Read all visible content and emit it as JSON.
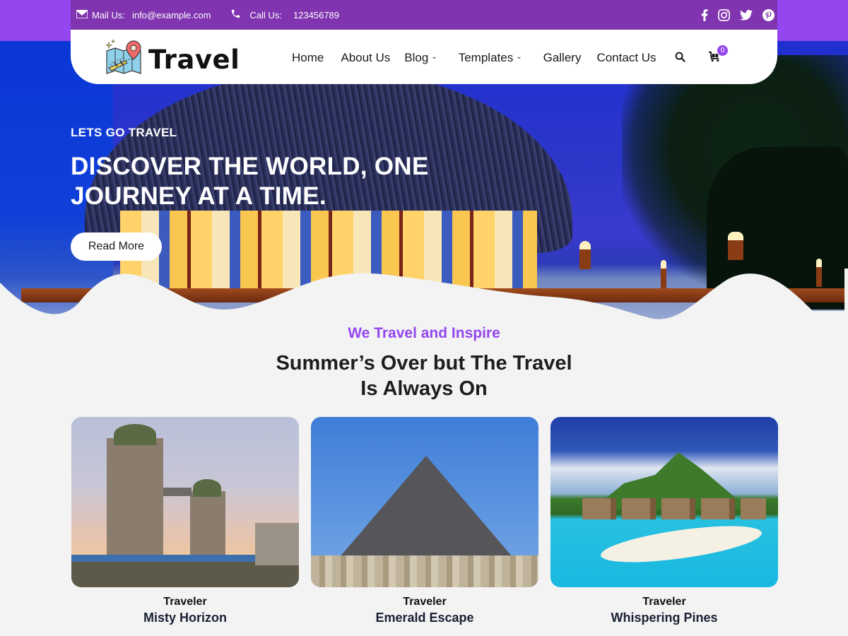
{
  "topbar": {
    "mail_label": "Mail Us:",
    "mail_value": "info@example.com",
    "call_label": "Call Us:",
    "call_value": "123456789",
    "social": [
      "facebook-icon",
      "instagram-icon",
      "twitter-icon",
      "pinterest-icon"
    ]
  },
  "brand": {
    "name": "Travel"
  },
  "nav": {
    "items": [
      {
        "label": "Home",
        "dropdown": false
      },
      {
        "label": "About Us",
        "dropdown": false
      },
      {
        "label": "Blog",
        "dropdown": true
      },
      {
        "label": "Templates",
        "dropdown": true
      },
      {
        "label": "Gallery",
        "dropdown": false
      },
      {
        "label": "Contact Us",
        "dropdown": false
      }
    ],
    "cart_count": "0"
  },
  "hero": {
    "subtitle": "LETS GO TRAVEL",
    "title": "DISCOVER THE WORLD, ONE JOURNEY AT A TIME.",
    "button_label": "Read More"
  },
  "section": {
    "eyebrow": "We Travel and Inspire",
    "heading_line1": "Summer’s Over but The Travel",
    "heading_line2": "Is Always On",
    "cards": [
      {
        "kicker": "Traveler",
        "title": "Misty Horizon",
        "image": "tower-bridge-london"
      },
      {
        "kicker": "Traveler",
        "title": "Emerald Escape",
        "image": "pyramid-giza"
      },
      {
        "kicker": "Traveler",
        "title": "Whispering Pines",
        "image": "tropical-island-bungalows"
      }
    ]
  },
  "colors": {
    "accent": "#9447ee",
    "topbar": "#8034b0",
    "text_dark": "#1d1d1d"
  }
}
